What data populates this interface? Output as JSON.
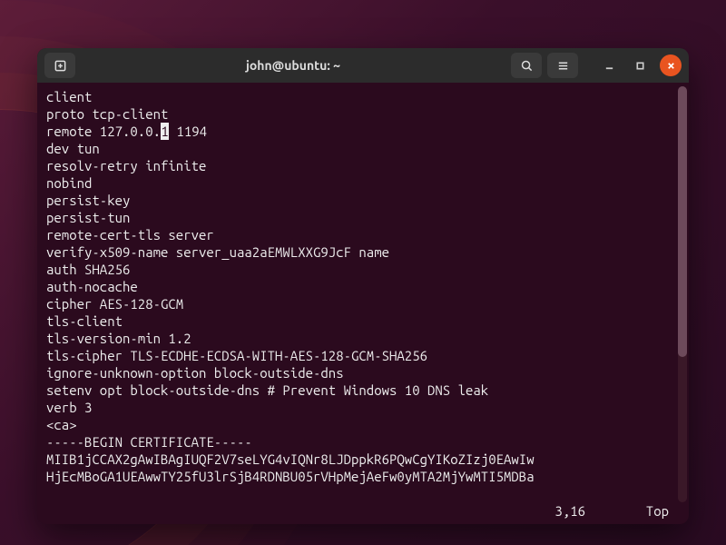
{
  "titlebar": {
    "title": "john@ubuntu: ~",
    "new_tab_icon": "new-tab-icon",
    "search_icon": "search-icon",
    "menu_icon": "hamburger-icon",
    "minimize_icon": "minimize-icon",
    "maximize_icon": "maximize-icon",
    "close_icon": "close-icon"
  },
  "editor": {
    "cursor_line_index": 2,
    "cursor_col": 16,
    "lines_before_cursor": [
      "client",
      "proto tcp-client"
    ],
    "cursor_line_left": "remote 127.0.0.",
    "cursor_char": "1",
    "cursor_line_right": " 1194",
    "lines_after_cursor": [
      "dev tun",
      "resolv-retry infinite",
      "nobind",
      "persist-key",
      "persist-tun",
      "remote-cert-tls server",
      "verify-x509-name server_uaa2aEMWLXXG9JcF name",
      "auth SHA256",
      "auth-nocache",
      "cipher AES-128-GCM",
      "tls-client",
      "tls-version-min 1.2",
      "tls-cipher TLS-ECDHE-ECDSA-WITH-AES-128-GCM-SHA256",
      "ignore-unknown-option block-outside-dns",
      "setenv opt block-outside-dns # Prevent Windows 10 DNS leak",
      "verb 3",
      "<ca>",
      "-----BEGIN CERTIFICATE-----",
      "MIIB1jCCAX2gAwIBAgIUQF2V7seLYG4vIQNr8LJDppkR6PQwCgYIKoZIzj0EAwIw",
      "HjEcMBoGA1UEAwwTY25fU3lrSjB4RDNBU05rVHpMejAeFw0yMTA2MjYwMTI5MDBa"
    ]
  },
  "status": {
    "position": "3,16",
    "scroll": "Top"
  },
  "colors": {
    "accent": "#e95420",
    "terminal_bg": "#2b0a1e",
    "text": "#eeeeee"
  }
}
